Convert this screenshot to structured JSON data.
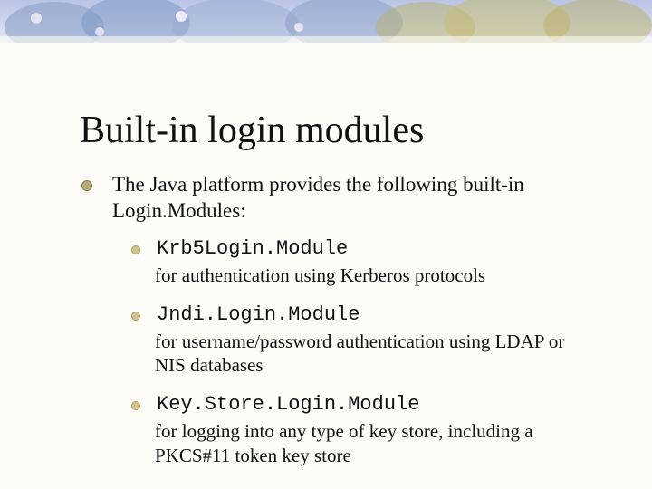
{
  "title": "Built-in login modules",
  "intro": "The Java platform provides the following built-in Login.Modules:",
  "modules": [
    {
      "name": "Krb5Login.Module",
      "desc": "for authentication using Kerberos protocols"
    },
    {
      "name": "Jndi.Login.Module",
      "desc": "for username/password authentication using LDAP or NIS databases"
    },
    {
      "name": "Key.Store.Login.Module",
      "desc": "for logging into any type of key store, including a PKCS#11 token key store"
    }
  ]
}
